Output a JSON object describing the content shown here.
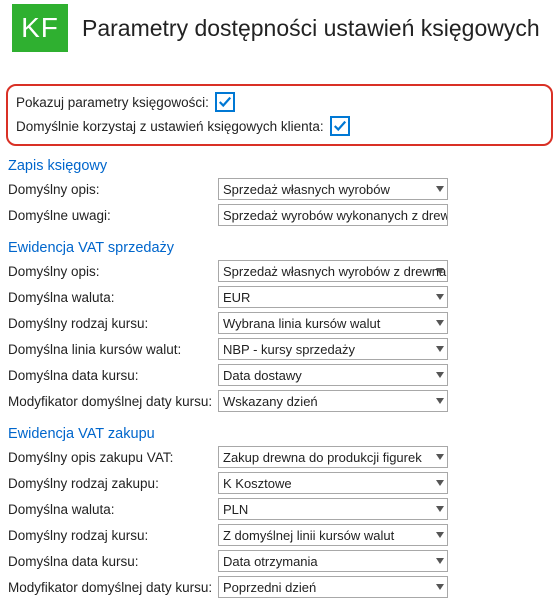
{
  "header": {
    "logo_text": "KF",
    "title": "Parametry dostępności ustawień księgowych"
  },
  "highlight": {
    "show_params_label": "Pokazuj parametry księgowości:",
    "show_params_checked": true,
    "use_client_settings_label": "Domyślnie korzystaj z ustawień księgowych klienta:",
    "use_client_settings_checked": true
  },
  "sections": {
    "zapis": {
      "title": "Zapis księgowy",
      "default_desc_label": "Domyślny opis:",
      "default_desc_value": "Sprzedaż własnych wyrobów",
      "default_notes_label": "Domyślne uwagi:",
      "default_notes_value": "Sprzedaż wyrobów wykonanych z drewna"
    },
    "vat_sale": {
      "title": "Ewidencja VAT sprzedaży",
      "desc_label": "Domyślny opis:",
      "desc_value": "Sprzedaż własnych wyrobów z drewna",
      "currency_label": "Domyślna waluta:",
      "currency_value": "EUR",
      "rate_type_label": "Domyślny rodzaj kursu:",
      "rate_type_value": "Wybrana linia kursów walut",
      "rate_line_label": "Domyślna linia kursów walut:",
      "rate_line_value": "NBP - kursy sprzedaży",
      "rate_date_label": "Domyślna data kursu:",
      "rate_date_value": "Data dostawy",
      "rate_mod_label": "Modyfikator domyślnej daty kursu:",
      "rate_mod_value": "Wskazany dzień"
    },
    "vat_purchase": {
      "title": "Ewidencja VAT zakupu",
      "desc_label": "Domyślny opis zakupu VAT:",
      "desc_value": "Zakup drewna do produkcji figurek",
      "purchase_type_label": "Domyślny rodzaj zakupu:",
      "purchase_type_value": "K  Kosztowe",
      "currency_label": "Domyślna waluta:",
      "currency_value": "PLN",
      "rate_type_label": "Domyślny rodzaj kursu:",
      "rate_type_value": "Z domyślnej linii kursów walut",
      "rate_date_label": "Domyślna data kursu:",
      "rate_date_value": "Data otrzymania",
      "rate_mod_label": "Modyfikator domyślnej daty kursu:",
      "rate_mod_value": "Poprzedni dzień"
    }
  }
}
